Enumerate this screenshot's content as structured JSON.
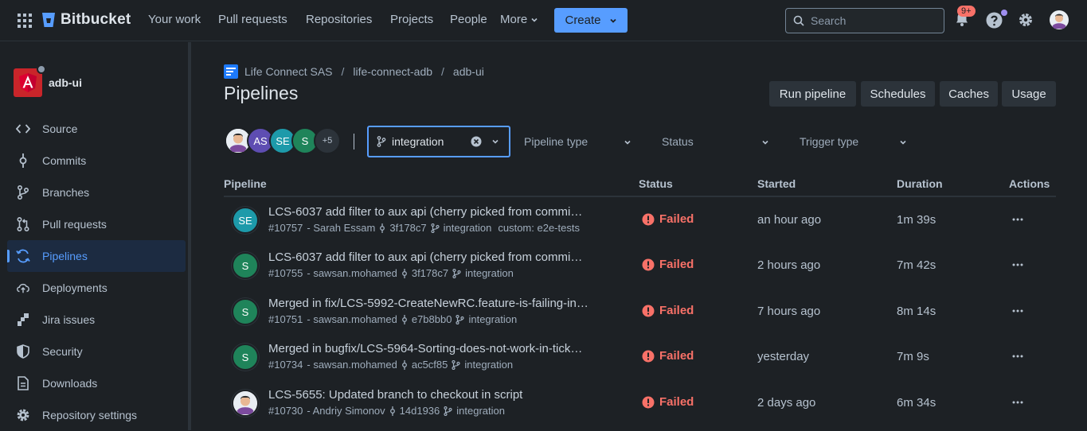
{
  "nav": {
    "brand": "Bitbucket",
    "links": [
      "Your work",
      "Pull requests",
      "Repositories",
      "Projects",
      "People",
      "More"
    ],
    "create_label": "Create",
    "search_placeholder": "Search",
    "notification_badge": "9+"
  },
  "sidebar": {
    "repo_name": "adb-ui",
    "items": [
      {
        "label": "Source",
        "icon": "code-icon"
      },
      {
        "label": "Commits",
        "icon": "commit-icon"
      },
      {
        "label": "Branches",
        "icon": "branch-icon"
      },
      {
        "label": "Pull requests",
        "icon": "pull-request-icon"
      },
      {
        "label": "Pipelines",
        "icon": "pipelines-icon",
        "active": true
      },
      {
        "label": "Deployments",
        "icon": "cloud-upload-icon"
      },
      {
        "label": "Jira issues",
        "icon": "jira-icon"
      },
      {
        "label": "Security",
        "icon": "shield-icon"
      },
      {
        "label": "Downloads",
        "icon": "document-icon"
      },
      {
        "label": "Repository settings",
        "icon": "gear-icon"
      }
    ]
  },
  "breadcrumb": [
    "Life Connect SAS",
    "life-connect-adb",
    "adb-ui"
  ],
  "page_title": "Pipelines",
  "header_buttons": [
    "Run pipeline",
    "Schedules",
    "Caches",
    "Usage"
  ],
  "filters": {
    "avatars": [
      "",
      "AS",
      "SE",
      "S"
    ],
    "more_count": "+5",
    "branch": "integration",
    "pipeline_type": "Pipeline type",
    "status": "Status",
    "trigger_type": "Trigger type"
  },
  "table": {
    "headers": [
      "Pipeline",
      "Status",
      "Started",
      "Duration",
      "Actions"
    ],
    "rows": [
      {
        "avatar": "SE",
        "avatar_color": "#1d9aaa",
        "title": "LCS-6037 add filter to aux api (cherry picked from commi…",
        "number": "#10757",
        "author": "- Sarah Essam",
        "commit": "3f178c7",
        "branch": "integration",
        "extra": "custom: e2e-tests",
        "status": "Failed",
        "started": "an hour ago",
        "duration": "1m 39s"
      },
      {
        "avatar": "S",
        "avatar_color": "#1f845a",
        "title": "LCS-6037 add filter to aux api (cherry picked from commi…",
        "number": "#10755",
        "author": "- sawsan.mohamed",
        "commit": "3f178c7",
        "branch": "integration",
        "extra": "",
        "status": "Failed",
        "started": "2 hours ago",
        "duration": "7m 42s"
      },
      {
        "avatar": "S",
        "avatar_color": "#1f845a",
        "title": "Merged in fix/LCS-5992-CreateNewRC.feature-is-failing-in…",
        "number": "#10751",
        "author": "- sawsan.mohamed",
        "commit": "e7b8bb0",
        "branch": "integration",
        "extra": "",
        "status": "Failed",
        "started": "7 hours ago",
        "duration": "8m 14s"
      },
      {
        "avatar": "S",
        "avatar_color": "#1f845a",
        "title": "Merged in bugfix/LCS-5964-Sorting-does-not-work-in-tick…",
        "number": "#10734",
        "author": "- sawsan.mohamed",
        "commit": "ac5cf85",
        "branch": "integration",
        "extra": "",
        "status": "Failed",
        "started": "yesterday",
        "duration": "7m 9s"
      },
      {
        "avatar": "",
        "avatar_color": "#e9eef3",
        "title": "LCS-5655: Updated branch to checkout in script",
        "number": "#10730",
        "author": "- Andriy Simonov",
        "commit": "14d1936",
        "branch": "integration",
        "extra": "",
        "status": "Failed",
        "started": "2 days ago",
        "duration": "6m 34s"
      }
    ]
  },
  "colors": {
    "accent": "#579dff",
    "failed": "#f87168",
    "background": "#1d2125"
  }
}
